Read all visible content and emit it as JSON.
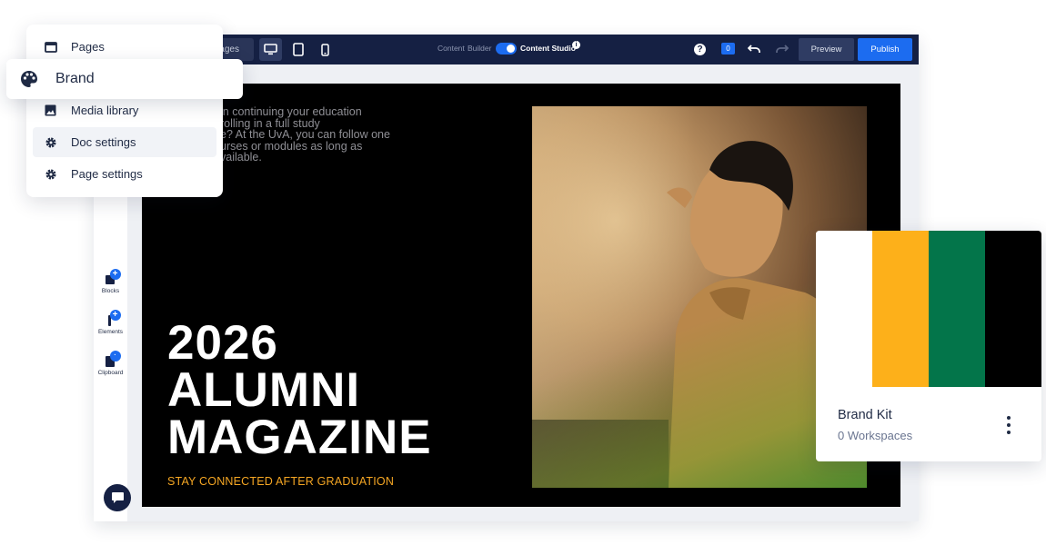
{
  "topbar": {
    "pages_tab_label": "Pages",
    "device_modes": [
      "desktop-icon",
      "tablet-icon",
      "mobile-icon"
    ],
    "active_device": "desktop",
    "mode_switch": {
      "off_label_1": "Content",
      "off_label_2": "Builder",
      "on_label": "Content Studio",
      "enabled": true,
      "info_glyph": "i"
    },
    "help_glyph": "?",
    "comment_count": "0",
    "preview_label": "Preview",
    "publish_label": "Publish"
  },
  "left_rail": {
    "tools": [
      {
        "label": "Blocks",
        "icon": "blocks-icon"
      },
      {
        "label": "Elements",
        "icon": "elements-icon"
      },
      {
        "label": "Clipboard",
        "icon": "clipboard-icon"
      }
    ],
    "plus_glyph": "+"
  },
  "canvas": {
    "intro_lines": [
      "in continuing your education",
      "rolling in a full study",
      "e? At the UvA, you can follow one",
      "urses or modules as long as",
      "vailable."
    ],
    "title_lines": [
      "2026",
      "ALUMNI",
      "MAGAZINE"
    ],
    "subtitle": "STAY CONNECTED AFTER GRADUATION"
  },
  "menu": {
    "items": [
      {
        "label": "Pages",
        "icon": "window-icon"
      },
      {
        "label": "Media library",
        "icon": "image-icon"
      },
      {
        "label": "Doc settings",
        "icon": "gear-icon"
      },
      {
        "label": "Page settings",
        "icon": "gear-icon"
      }
    ],
    "hovered_item": "Doc settings",
    "brand_popup": {
      "label": "Brand",
      "icon": "palette-icon"
    }
  },
  "brand_kit": {
    "title": "Brand Kit",
    "subtitle": "0 Workspaces",
    "colors": [
      "#ffffff",
      "#fdb01a",
      "#03754a",
      "#000000"
    ]
  },
  "colors": {
    "topbar": "#152043",
    "accent_blue": "#1c6cf0",
    "title_orange": "#f5a623"
  }
}
